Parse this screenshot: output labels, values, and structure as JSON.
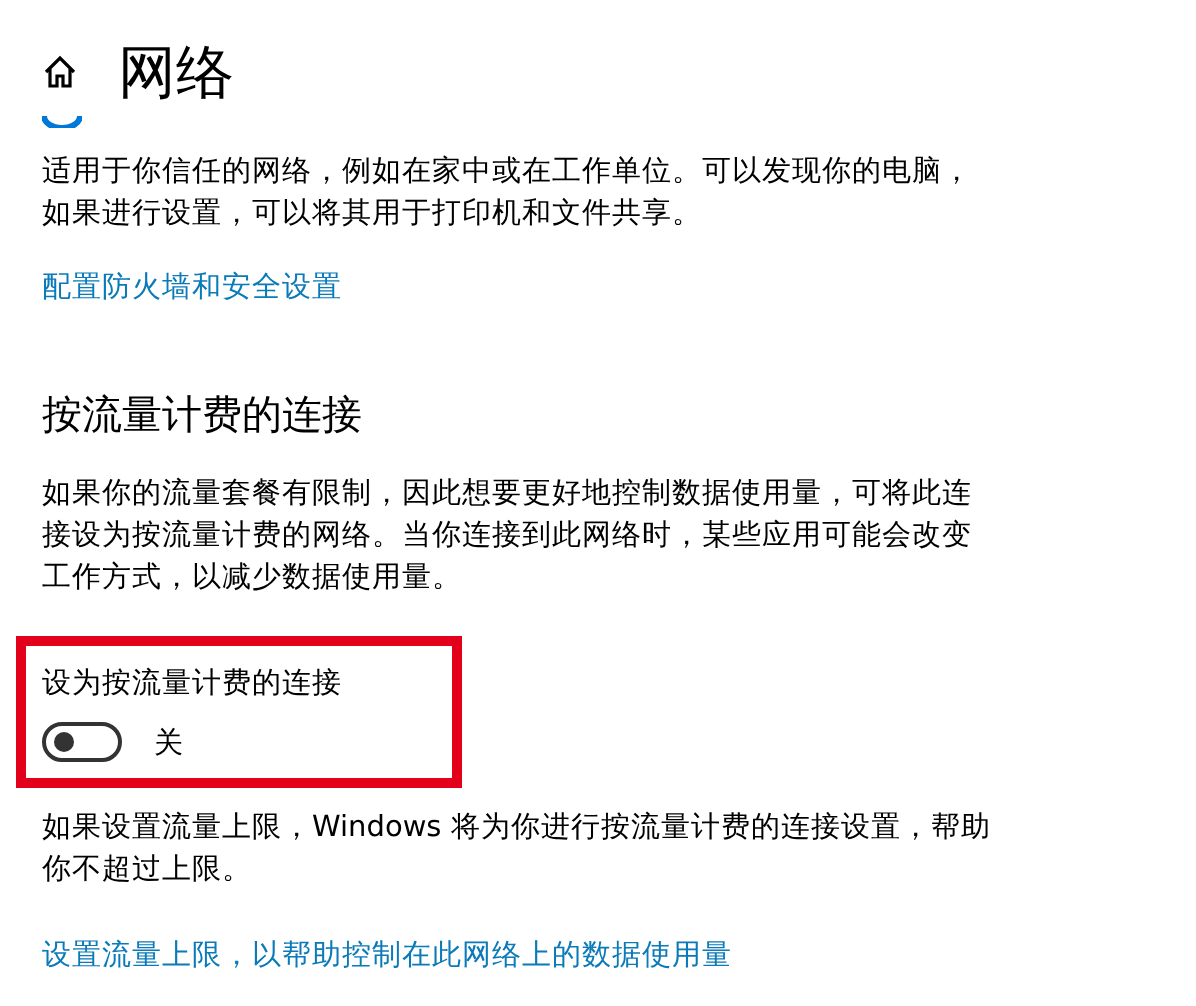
{
  "header": {
    "title": "网络"
  },
  "network_profile": {
    "selected": true,
    "description": "适用于你信任的网络，例如在家中或在工作单位。可以发现你的电脑，如果进行设置，可以将其用于打印机和文件共享。",
    "link": "配置防火墙和安全设置"
  },
  "metered": {
    "heading": "按流量计费的连接",
    "description": "如果你的流量套餐有限制，因此想要更好地控制数据使用量，可将此连接设为按流量计费的网络。当你连接到此网络时，某些应用可能会改变工作方式，以减少数据使用量。",
    "toggle_label": "设为按流量计费的连接",
    "on": false,
    "state_text": "关",
    "note": "如果设置流量上限，Windows 将为你进行按流量计费的连接设置，帮助你不超过上限。",
    "link": "设置流量上限，以帮助控制在此网络上的数据使用量"
  }
}
